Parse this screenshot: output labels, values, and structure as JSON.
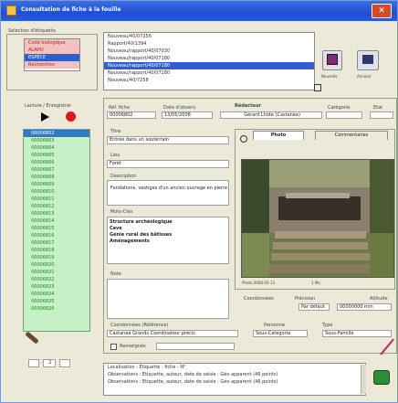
{
  "window": {
    "title": "Consultation de fiche à la fouille"
  },
  "left_top": {
    "header": "Sélection d'étiquette",
    "items": [
      {
        "label": "Code biologique",
        "style": "pink"
      },
      {
        "label": "ALAPO",
        "style": "pink"
      },
      {
        "label": "ESPÈCE",
        "style": "selected"
      },
      {
        "label": "Recherches",
        "style": "pink"
      }
    ]
  },
  "player": {
    "label": "Lecture / Enregistrer"
  },
  "green_list": [
    "00006802",
    "00006803",
    "00006804",
    "00006805",
    "00006806",
    "00006807",
    "00006808",
    "00006809",
    "00006810",
    "00006811",
    "00006812",
    "00006813",
    "00006814",
    "00006815",
    "00006816",
    "00006817",
    "00006818",
    "00006819",
    "00006820",
    "00006821",
    "00006822",
    "00006823",
    "00006824",
    "00006825",
    "00006826"
  ],
  "pager": {
    "value": "1"
  },
  "records": [
    {
      "label": "Nouveau/40/07256"
    },
    {
      "label": "Rapport/40/1394"
    },
    {
      "label": "Nouveau/rapport/40/07030"
    },
    {
      "label": "Nouveau/rapport/40/07180"
    },
    {
      "label": "Nouveau/rapport/40/07180",
      "selected": true
    },
    {
      "label": "Nouveau/rapport/40/07180"
    },
    {
      "label": "Nouveau/40/7258"
    }
  ],
  "buttons": {
    "b1": "Nouvelle",
    "b2": "Annuler"
  },
  "fields": {
    "f1_label": "Réf. fiche",
    "f1_value": "00006802",
    "f2_label": "Date d'observ.",
    "f2_value": "13/05/2008",
    "f3_label": "Rédacteur",
    "f3_value": "Gérard Lhôte (Castanea)",
    "f4_label": "Catégorie",
    "f5_label": "Etat",
    "title_label": "Titre",
    "title_value": "Entrée dans un souterrain",
    "lieu_label": "Lieu",
    "lieu_value": "Forêt",
    "desc_label": "Description",
    "desc_value": "Fondations, vestiges d'un ancien ouvrage en pierre",
    "motcles_label": "Mots-Clés",
    "motcles_values": [
      "Structure archéologique",
      "Cave",
      "Génie rural des bâtisses",
      "Aménagements"
    ],
    "note_label": "Note"
  },
  "tabs": {
    "t1": "Photo",
    "t2": "Commentaires"
  },
  "photo": {
    "caption": "Photo 2008-05-13",
    "size": "1 Mo"
  },
  "coords": {
    "label1": "Coordonnées",
    "label2": "Précision",
    "label3": "Altitude",
    "v1": "Par défaut",
    "v2": "00000000 mm"
  },
  "foot": {
    "label1": "Coordonnées (Référence)",
    "label2": "Personne",
    "label3": "Type",
    "v1": "Castanea Grands Coordinateur précis",
    "v2": "Sous-Catégorie",
    "v3": "Sous-Famille",
    "checkbox_label": "Renseignés"
  },
  "log": [
    "Localisation : Etiquette : fiche - N°",
    "Observations : Etiquette, auteur, date de saisie : Géo apparent (46 points)",
    "Observations : Etiquette, auteur, date de saisie : Géo apparent (46 points)"
  ]
}
